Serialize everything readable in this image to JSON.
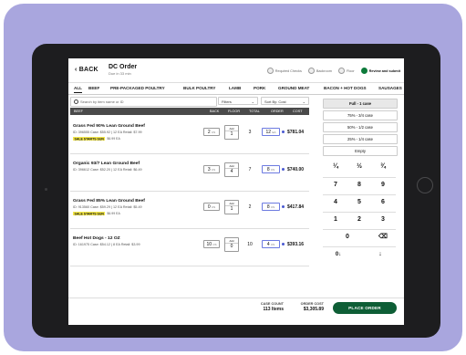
{
  "header": {
    "back_label": "BACK",
    "title": "DC Order",
    "subtitle": "Due in 33 min",
    "steps": [
      {
        "label": "Required Checks",
        "active": false
      },
      {
        "label": "Backroom",
        "active": false
      },
      {
        "label": "Floor",
        "active": false
      },
      {
        "label": "Review and submit",
        "active": true
      }
    ]
  },
  "tabs": [
    "ALL",
    "BEEF",
    "PRE-PACKAGED POULTRY",
    "BULK POULTRY",
    "LAMB",
    "PORK",
    "GROUND MEAT",
    "BACON + HOT DOGS",
    "SAUSAGES"
  ],
  "search": {
    "placeholder": "Search by item name or ID"
  },
  "filters": {
    "filter_label": "Filters",
    "sort_label": "Sort By: Cost"
  },
  "columns": {
    "item": "BEEF",
    "back": "BACK",
    "floor": "FLOOR",
    "total": "TOTAL",
    "order": "ORDER",
    "cost": "COST"
  },
  "products": [
    {
      "name": "Grass Fed 90% Lean Ground Beef",
      "info": "ID: 396555  Case: $55.92 | 12 EA  Retail: $7.99",
      "sale": "SALE STARTS SUN",
      "sale_price": "$6.99 EA",
      "back": "2",
      "floor_label": "Add",
      "floor": "1",
      "total": "3",
      "order": "12",
      "unit": "EA",
      "cost": "$781.04"
    },
    {
      "name": "Organic 93/7 Lean Ground Beef",
      "info": "ID: 396612  Case: $52.20 | 12 EA  Retail: $6.49",
      "sale": "",
      "sale_price": "",
      "back": "3",
      "floor_label": "Add",
      "floor": "4",
      "total": "7",
      "order": "8",
      "unit": "CS",
      "cost": "$740.00"
    },
    {
      "name": "Grass Fed 85% Lean Ground Beef",
      "info": "ID: 913560  Case: $59.29 | 12 EA  Retail: $5.49",
      "sale": "SALE STARTS SUN",
      "sale_price": "$6.99 EA",
      "back": "0",
      "floor_label": "Add",
      "floor": "1",
      "total": "2",
      "order": "8",
      "unit": "CS",
      "cost": "$417.84"
    },
    {
      "name": "Beef Hot Dogs - 12 OZ",
      "info": "ID: 161975  Case: $54.12 | 8 EA  Retail: $3.99",
      "sale": "",
      "sale_price": "",
      "back": "10",
      "floor_label": "Add",
      "floor": "0",
      "total": "10",
      "order": "4",
      "unit": "CS",
      "cost": "$393.16"
    }
  ],
  "keypad": {
    "presets": [
      "Full - 1 case",
      "75% - 3/4 case",
      "50% - 1/2 case",
      "25% - 1/4 case",
      "Empty"
    ],
    "fractions": [
      "¼",
      "½",
      "¾"
    ],
    "digits": [
      "7",
      "8",
      "9",
      "4",
      "5",
      "6",
      "1",
      "2",
      "3",
      "0"
    ],
    "backspace": "⌫",
    "down_label": "0↓",
    "next": "↓"
  },
  "footer": {
    "case_count_label": "CASE COUNT",
    "case_count_value": "113 Items",
    "order_cost_label": "ORDER COST",
    "order_cost_value": "$3,305.89",
    "place_order": "PLACE ORDER"
  },
  "colors": {
    "accent": "#0e5e36",
    "frame": "#a9a6de",
    "sale": "#f4e84a",
    "order_dot": "#4a5ad1"
  }
}
